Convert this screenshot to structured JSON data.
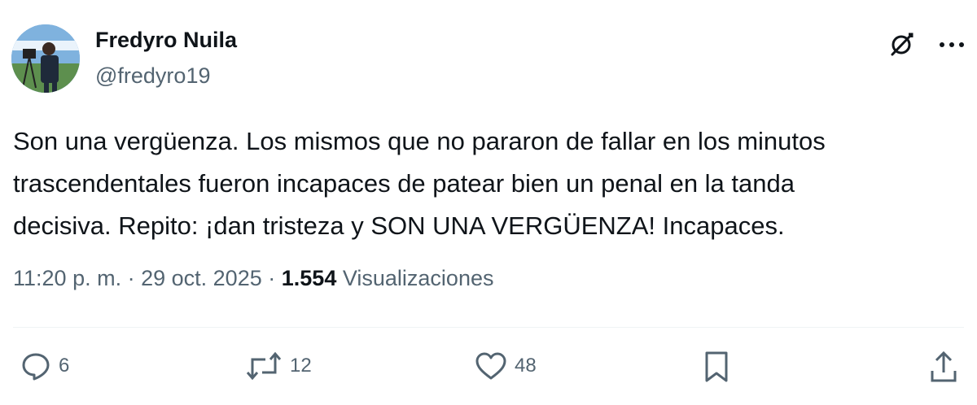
{
  "author": {
    "name": "Fredyro Nuila",
    "handle": "@fredyro19"
  },
  "tweet": {
    "text": "Son una vergüenza. Los mismos que no pararon de fallar en los minutos\ntrascendentales fueron incapaces de patear bien un penal en la tanda\ndecisiva. Repito: ¡dan tristeza y SON UNA VERGÜENZA! Incapaces."
  },
  "meta": {
    "time": "11:20 p. m.",
    "sep1": "·",
    "date": "29 oct. 2025",
    "sep2": "·",
    "views_count": "1.554",
    "views_label": "Visualizaciones"
  },
  "actions": {
    "replies": "6",
    "reposts": "12",
    "likes": "48"
  },
  "icons": {
    "top": [
      "grok-icon",
      "more-icon"
    ],
    "actions": [
      "reply-icon",
      "repost-icon",
      "like-icon",
      "bookmark-icon",
      "share-icon"
    ]
  },
  "colors": {
    "text": "#0f1419",
    "secondary": "#536471",
    "divider": "#eff3f4"
  }
}
